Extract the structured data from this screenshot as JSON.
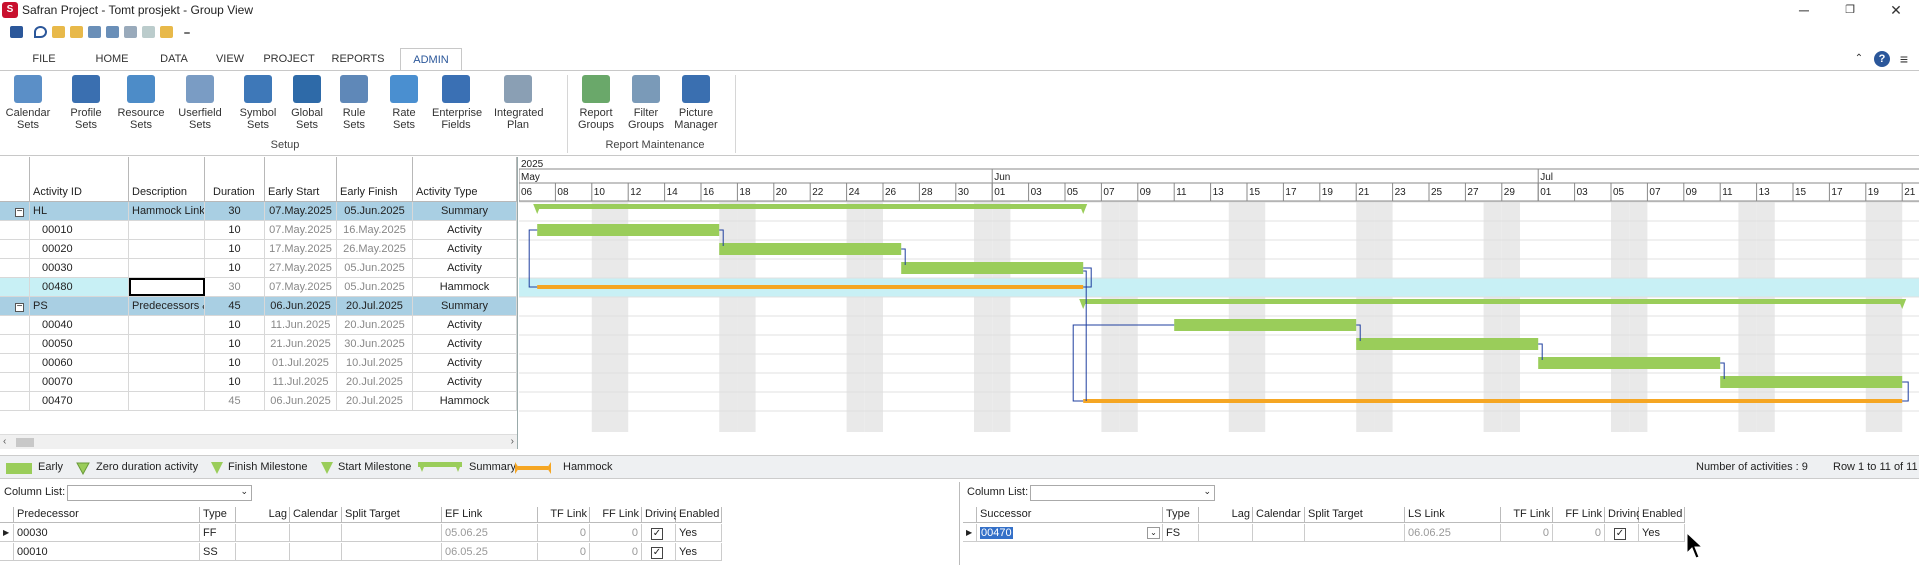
{
  "window": {
    "title": "Safran Project - Tomt prosjekt - Group View",
    "minimize_glyph": "─",
    "restore_glyph": "❐",
    "close_glyph": "✕"
  },
  "tabs": [
    "FILE",
    "HOME",
    "DATA",
    "VIEW",
    "PROJECT",
    "REPORTS",
    "ADMIN"
  ],
  "active_tab": "ADMIN",
  "ribbon": {
    "setup_buttons": [
      {
        "l1": "Calendar",
        "l2": "Sets",
        "icon": "calendar-icon"
      },
      {
        "l1": "Profile",
        "l2": "Sets",
        "icon": "profile-icon"
      },
      {
        "l1": "Resource",
        "l2": "Sets",
        "icon": "resource-icon"
      },
      {
        "l1": "Userfield",
        "l2": "Sets",
        "icon": "userfield-icon"
      },
      {
        "l1": "Symbol",
        "l2": "Sets",
        "icon": "symbol-icon"
      },
      {
        "l1": "Global",
        "l2": "Sets",
        "icon": "global-icon"
      },
      {
        "l1": "Rule",
        "l2": "Sets",
        "icon": "rule-icon"
      },
      {
        "l1": "Rate",
        "l2": "Sets",
        "icon": "rate-icon"
      },
      {
        "l1": "Enterprise",
        "l2": "Fields",
        "icon": "enterprise-icon"
      },
      {
        "l1": "Integrated",
        "l2": "Plan",
        "icon": "integrated-plan-icon"
      }
    ],
    "setup_label": "Setup",
    "report_buttons": [
      {
        "l1": "Report",
        "l2": "Groups",
        "icon": "report-groups-icon"
      },
      {
        "l1": "Filter",
        "l2": "Groups",
        "icon": "filter-groups-icon"
      },
      {
        "l1": "Picture",
        "l2": "Manager",
        "icon": "picture-manager-icon"
      }
    ],
    "report_label": "Report Maintenance"
  },
  "grid": {
    "headers": [
      "Activity ID",
      "Description",
      "Duration",
      "Early Start",
      "Early Finish",
      "Activity Type"
    ],
    "rows": [
      {
        "id": "HL",
        "desc": "Hammock Links",
        "dur": "30",
        "es": "07.May.2025",
        "ef": "05.Jun.2025",
        "type": "Summary",
        "kind": "summary"
      },
      {
        "id": "00010",
        "desc": "",
        "dur": "10",
        "es": "07.May.2025",
        "ef": "16.May.2025",
        "type": "Activity",
        "kind": "activity"
      },
      {
        "id": "00020",
        "desc": "",
        "dur": "10",
        "es": "17.May.2025",
        "ef": "26.May.2025",
        "type": "Activity",
        "kind": "activity"
      },
      {
        "id": "00030",
        "desc": "",
        "dur": "10",
        "es": "27.May.2025",
        "ef": "05.Jun.2025",
        "type": "Activity",
        "kind": "activity"
      },
      {
        "id": "00480",
        "desc": "",
        "dur": "30",
        "es": "07.May.2025",
        "ef": "05.Jun.2025",
        "type": "Hammock",
        "kind": "hammock"
      },
      {
        "id": "PS",
        "desc": "Predecessors & Successors",
        "dur": "45",
        "es": "06.Jun.2025",
        "ef": "20.Jul.2025",
        "type": "Summary",
        "kind": "summary"
      },
      {
        "id": "00040",
        "desc": "",
        "dur": "10",
        "es": "11.Jun.2025",
        "ef": "20.Jun.2025",
        "type": "Activity",
        "kind": "activity"
      },
      {
        "id": "00050",
        "desc": "",
        "dur": "10",
        "es": "21.Jun.2025",
        "ef": "30.Jun.2025",
        "type": "Activity",
        "kind": "activity"
      },
      {
        "id": "00060",
        "desc": "",
        "dur": "10",
        "es": "01.Jul.2025",
        "ef": "10.Jul.2025",
        "type": "Activity",
        "kind": "activity"
      },
      {
        "id": "00070",
        "desc": "",
        "dur": "10",
        "es": "11.Jul.2025",
        "ef": "20.Jul.2025",
        "type": "Activity",
        "kind": "activity"
      },
      {
        "id": "00470",
        "desc": "",
        "dur": "45",
        "es": "06.Jun.2025",
        "ef": "20.Jul.2025",
        "type": "Hammock",
        "kind": "hammock2"
      }
    ]
  },
  "gantt": {
    "year": "2025",
    "months": [
      {
        "label": "May",
        "startDay": 0
      },
      {
        "label": "Jun",
        "startDay": 26
      },
      {
        "label": "Jul",
        "startDay": 56
      }
    ],
    "day_labels": [
      "06",
      "08",
      "10",
      "12",
      "14",
      "16",
      "18",
      "20",
      "22",
      "24",
      "26",
      "28",
      "30",
      "01",
      "03",
      "05",
      "07",
      "09",
      "11",
      "13",
      "15",
      "17",
      "19",
      "21",
      "23",
      "25",
      "27",
      "29",
      "01",
      "03",
      "05",
      "07",
      "09",
      "11",
      "13",
      "15",
      "17",
      "19",
      "21"
    ],
    "bars": [
      {
        "row": 0,
        "start": 1,
        "end": 31,
        "type": "summary"
      },
      {
        "row": 1,
        "start": 1,
        "end": 11,
        "type": "early"
      },
      {
        "row": 2,
        "start": 11,
        "end": 21,
        "type": "early"
      },
      {
        "row": 3,
        "start": 21,
        "end": 31,
        "type": "early"
      },
      {
        "row": 4,
        "start": 1,
        "end": 31,
        "type": "hammock"
      },
      {
        "row": 5,
        "start": 31,
        "end": 76,
        "type": "summary"
      },
      {
        "row": 6,
        "start": 36,
        "end": 46,
        "type": "early"
      },
      {
        "row": 7,
        "start": 46,
        "end": 56,
        "type": "early"
      },
      {
        "row": 8,
        "start": 56,
        "end": 66,
        "type": "early"
      },
      {
        "row": 9,
        "start": 66,
        "end": 76,
        "type": "early"
      },
      {
        "row": 10,
        "start": 31,
        "end": 76,
        "type": "hammock"
      }
    ]
  },
  "legend": {
    "items": [
      "Early",
      "Zero duration activity",
      "Finish Milestone",
      "Start Milestone",
      "Summary",
      "Hammock"
    ],
    "count": "Number of activities : 9",
    "rows": "Row 1 to 11 of 11"
  },
  "pred": {
    "column_list_label": "Column List:",
    "headers": [
      "Predecessor",
      "Type",
      "Lag",
      "Calendar",
      "Split Target",
      "EF Link",
      "TF Link",
      "FF Link",
      "Driving",
      "Enabled"
    ],
    "rows": [
      {
        "id": "00030",
        "type": "FF",
        "lag": "",
        "cal": "",
        "split": "",
        "link": "05.06.25",
        "tf": "0",
        "ff": "0",
        "driving": "✓",
        "enabled": "Yes"
      },
      {
        "id": "00010",
        "type": "SS",
        "lag": "",
        "cal": "",
        "split": "",
        "link": "06.05.25",
        "tf": "0",
        "ff": "0",
        "driving": "✓",
        "enabled": "Yes"
      }
    ]
  },
  "succ": {
    "column_list_label": "Column List:",
    "headers": [
      "Successor",
      "Type",
      "Lag",
      "Calendar",
      "Split Target",
      "LS Link",
      "TF Link",
      "FF Link",
      "Driving",
      "Enabled"
    ],
    "rows": [
      {
        "id": "00470",
        "type": "FS",
        "lag": "",
        "cal": "",
        "split": "",
        "link": "06.06.25",
        "tf": "0",
        "ff": "0",
        "driving": "✓",
        "enabled": "Yes"
      }
    ]
  }
}
